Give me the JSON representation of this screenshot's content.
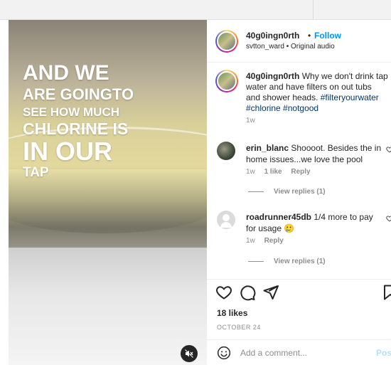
{
  "video": {
    "overlay_lines": [
      "AND WE",
      "ARE GOINGTO",
      "SEE HOW MUCH",
      "CHLORINE IS",
      "IN OUR",
      "TAP"
    ],
    "mute_icon": "speaker-muted-icon"
  },
  "header": {
    "username": "40g0ingn0rth",
    "separator": "•",
    "follow_label": "Follow",
    "subtitle": "svtton_ward • Original audio"
  },
  "caption": {
    "username": "40g0ingn0rth",
    "text": "Why we don't drink tap water and have filters on out tubs and shower heads.",
    "hashtags": [
      "#filteryourwater",
      "#chlorine",
      "#notgood"
    ],
    "time": "1w"
  },
  "comments": [
    {
      "username": "erin_blanc",
      "text": "Shoooot. Besides the in home issues...we love the pool",
      "time": "1w",
      "likes": "1 like",
      "reply_label": "Reply",
      "view_replies": "View replies (1)"
    },
    {
      "username": "roadrunner45db",
      "text": "1/4 more to pay for usage 🥲",
      "time": "1w",
      "reply_label": "Reply",
      "view_replies": "View replies (1)"
    }
  ],
  "actions": {
    "likes": "18 likes",
    "date": "OCTOBER 24"
  },
  "add_comment": {
    "placeholder": "Add a comment...",
    "post_label": "Post"
  }
}
